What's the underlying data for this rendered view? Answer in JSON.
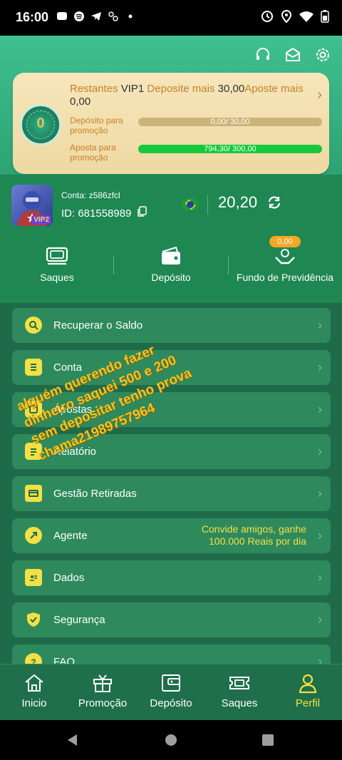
{
  "status": {
    "time": "16:00"
  },
  "header_icons": [
    "headset-icon",
    "mail-icon",
    "settings-icon"
  ],
  "vip": {
    "level_badge": "0",
    "line_part1": "Restantes",
    "line_vip": "VIP1",
    "line_deposit": "Deposite mais",
    "line_deposit_amount": "30,00",
    "line_bet": "Aposte mais",
    "line_bet_amount": "0,00",
    "deposit_label": "Depósito para promoção",
    "deposit_progress": "0,00/ 30,00",
    "deposit_fraction": 0.0,
    "bet_label": "Aposta para promoção",
    "bet_progress": "794,30/ 300,00",
    "bet_fraction": 1.0
  },
  "profile": {
    "avatar_badge": "VIP2",
    "account_label": "Conta:",
    "account_value": "z586zfcl",
    "id_label": "ID:",
    "id_value": "681558989",
    "balance": "20,20"
  },
  "actions": {
    "saques": "Saques",
    "deposito": "Depósito",
    "fundo": "Fundo de Previdência",
    "fundo_badge": "0,00"
  },
  "menu": [
    {
      "label": "Recuperar o Saldo",
      "icon": "search-coin-icon"
    },
    {
      "label": "Conta",
      "icon": "list-icon"
    },
    {
      "label": "Apostas",
      "icon": "bets-icon"
    },
    {
      "label": "Relatório",
      "icon": "report-icon"
    },
    {
      "label": "Gestão Retiradas",
      "icon": "card-icon"
    },
    {
      "label": "Agente",
      "icon": "share-icon",
      "extra": "Convide amigos, ganhe 100.000 Reais por dia"
    },
    {
      "label": "Dados",
      "icon": "id-card-icon"
    },
    {
      "label": "Segurança",
      "icon": "shield-icon"
    },
    {
      "label": "FAQ",
      "icon": "question-icon"
    }
  ],
  "overlay": "alguém querendo fazer dinheiro saquei 500 e 200 sem depositar tenho prova chama21989757964",
  "tabs": [
    {
      "label": "Inicio",
      "icon": "home-icon"
    },
    {
      "label": "Promoção",
      "icon": "gift-icon"
    },
    {
      "label": "Depósito",
      "icon": "wallet-icon"
    },
    {
      "label": "Saques",
      "icon": "ticket-icon"
    },
    {
      "label": "Perfil",
      "icon": "person-icon"
    }
  ],
  "colors": {
    "accent": "#f2e045",
    "bg": "#1f6b49",
    "card": "#2e8a5c",
    "header": "#3fc08f",
    "progress": "#17c93a"
  }
}
